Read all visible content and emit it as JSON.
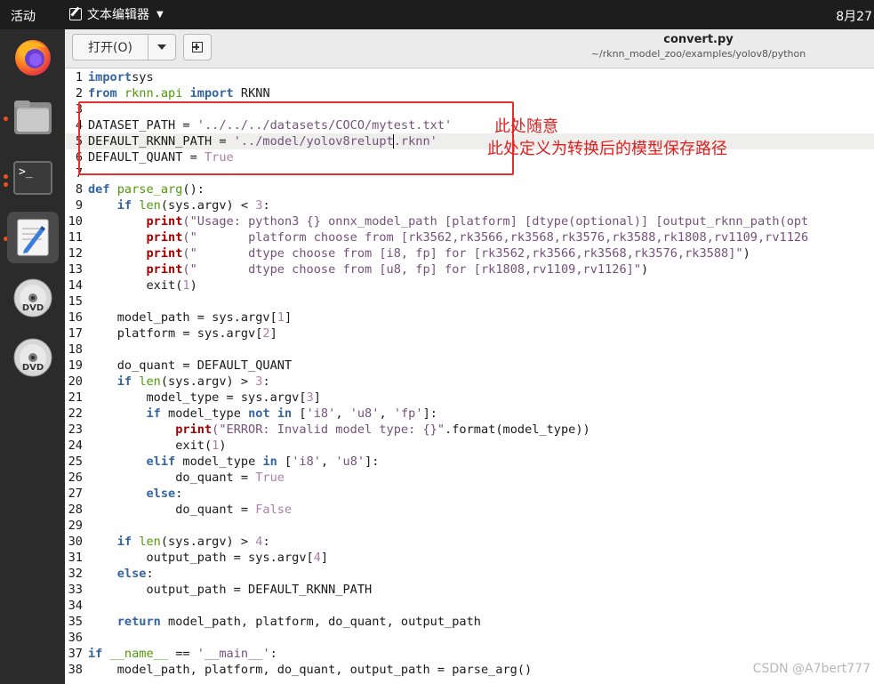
{
  "topbar": {
    "activities": "活动",
    "app_name": "文本编辑器",
    "clock": "8月27"
  },
  "dock": {
    "items": [
      {
        "name": "firefox-icon",
        "active": false,
        "running": false
      },
      {
        "name": "files-icon",
        "active": false,
        "running": true
      },
      {
        "name": "terminal-icon",
        "active": false,
        "running": true,
        "glyph": ">_"
      },
      {
        "name": "text-editor-icon",
        "active": true,
        "running": true
      },
      {
        "name": "dvd-icon",
        "label": "DVD"
      },
      {
        "name": "dvd-icon",
        "label": "DVD"
      }
    ]
  },
  "header": {
    "open_label": "打开(O)",
    "title": "convert.py",
    "subtitle": "~/rknn_model_zoo/examples/yolov8/python"
  },
  "annotation": {
    "note1": "此处随意",
    "note2": "此处定义为转换后的模型保存路径"
  },
  "watermark": "CSDN @A7bert777",
  "editor": {
    "lines": [
      {
        "n": "1",
        "t": [
          [
            "kw",
            "import"
          ],
          [
            "",
            "sys"
          ]
        ]
      },
      {
        "n": "2",
        "t": [
          [
            "kw",
            "from"
          ],
          [
            "",
            " "
          ],
          [
            "bi",
            "rknn.api"
          ],
          [
            "",
            " "
          ],
          [
            "kw",
            "import"
          ],
          [
            "",
            " RKNN"
          ]
        ]
      },
      {
        "n": "3",
        "t": []
      },
      {
        "n": "4",
        "t": [
          [
            "",
            "DATASET_PATH = "
          ],
          [
            "str",
            "'../../../datasets/COCO/mytest.txt'"
          ]
        ]
      },
      {
        "n": "5",
        "current": true,
        "t": [
          [
            "",
            "DEFAULT_RKNN_PATH = "
          ],
          [
            "str",
            "'../model/yolov8relupt"
          ],
          [
            "cursor",
            ""
          ],
          [
            "str",
            ".rknn'"
          ]
        ]
      },
      {
        "n": "6",
        "t": [
          [
            "",
            "DEFAULT_QUANT = "
          ],
          [
            "num",
            "True"
          ]
        ]
      },
      {
        "n": "7",
        "t": []
      },
      {
        "n": "8",
        "t": [
          [
            "kw",
            "def"
          ],
          [
            "",
            " "
          ],
          [
            "bi",
            "parse_arg"
          ],
          [
            "",
            "():"
          ]
        ]
      },
      {
        "n": "9",
        "t": [
          [
            "",
            "    "
          ],
          [
            "kw",
            "if"
          ],
          [
            "",
            " "
          ],
          [
            "bi",
            "len"
          ],
          [
            "",
            "(sys.argv) < "
          ],
          [
            "num",
            "3"
          ],
          [
            "",
            ":"
          ]
        ]
      },
      {
        "n": "10",
        "t": [
          [
            "",
            "        "
          ],
          [
            "kwp",
            "print"
          ],
          [
            "str",
            "(\"Usage: python3 {} onnx_model_path [platform] [dtype(optional)] [output_rknn_path(opt"
          ]
        ]
      },
      {
        "n": "11",
        "t": [
          [
            "",
            "        "
          ],
          [
            "kwp",
            "print"
          ],
          [
            "str",
            "(\"       platform choose from [rk3562,rk3566,rk3568,rk3576,rk3588,rk1808,rv1109,rv1126"
          ]
        ]
      },
      {
        "n": "12",
        "t": [
          [
            "",
            "        "
          ],
          [
            "kwp",
            "print"
          ],
          [
            "str",
            "(\"       dtype choose from [i8, fp] for [rk3562,rk3566,rk3568,rk3576,rk3588]\""
          ],
          [
            "",
            ")"
          ]
        ]
      },
      {
        "n": "13",
        "t": [
          [
            "",
            "        "
          ],
          [
            "kwp",
            "print"
          ],
          [
            "str",
            "(\"       dtype choose from [u8, fp] for [rk1808,rv1109,rv1126]\""
          ],
          [
            "",
            ")"
          ]
        ]
      },
      {
        "n": "14",
        "t": [
          [
            "",
            "        exit("
          ],
          [
            "num",
            "1"
          ],
          [
            "",
            ")"
          ]
        ]
      },
      {
        "n": "15",
        "t": []
      },
      {
        "n": "16",
        "t": [
          [
            "",
            "    model_path = sys.argv["
          ],
          [
            "num",
            "1"
          ],
          [
            "",
            "]"
          ]
        ]
      },
      {
        "n": "17",
        "t": [
          [
            "",
            "    platform = sys.argv["
          ],
          [
            "num",
            "2"
          ],
          [
            "",
            "]"
          ]
        ]
      },
      {
        "n": "18",
        "t": []
      },
      {
        "n": "19",
        "t": [
          [
            "",
            "    do_quant = DEFAULT_QUANT"
          ]
        ]
      },
      {
        "n": "20",
        "t": [
          [
            "",
            "    "
          ],
          [
            "kw",
            "if"
          ],
          [
            "",
            " "
          ],
          [
            "bi",
            "len"
          ],
          [
            "",
            "(sys.argv) > "
          ],
          [
            "num",
            "3"
          ],
          [
            "",
            ":"
          ]
        ]
      },
      {
        "n": "21",
        "t": [
          [
            "",
            "        model_type = sys.argv["
          ],
          [
            "num",
            "3"
          ],
          [
            "",
            "]"
          ]
        ]
      },
      {
        "n": "22",
        "t": [
          [
            "",
            "        "
          ],
          [
            "kw",
            "if"
          ],
          [
            "",
            " model_type "
          ],
          [
            "kw",
            "not in"
          ],
          [
            "",
            " ["
          ],
          [
            "str",
            "'i8'"
          ],
          [
            "",
            ", "
          ],
          [
            "str",
            "'u8'"
          ],
          [
            "",
            ", "
          ],
          [
            "str",
            "'fp'"
          ],
          [
            "",
            "]:"
          ]
        ]
      },
      {
        "n": "23",
        "t": [
          [
            "",
            "            "
          ],
          [
            "kwp",
            "print"
          ],
          [
            "str",
            "(\"ERROR: Invalid model type: {}\""
          ],
          [
            "",
            ".format(model_type))"
          ]
        ]
      },
      {
        "n": "24",
        "t": [
          [
            "",
            "            exit("
          ],
          [
            "num",
            "1"
          ],
          [
            "",
            ")"
          ]
        ]
      },
      {
        "n": "25",
        "t": [
          [
            "",
            "        "
          ],
          [
            "kw",
            "elif"
          ],
          [
            "",
            " model_type "
          ],
          [
            "kw",
            "in"
          ],
          [
            "",
            " ["
          ],
          [
            "str",
            "'i8'"
          ],
          [
            "",
            ", "
          ],
          [
            "str",
            "'u8'"
          ],
          [
            "",
            "]:"
          ]
        ]
      },
      {
        "n": "26",
        "t": [
          [
            "",
            "            do_quant = "
          ],
          [
            "num",
            "True"
          ]
        ]
      },
      {
        "n": "27",
        "t": [
          [
            "",
            "        "
          ],
          [
            "kw",
            "else"
          ],
          [
            "",
            ":"
          ]
        ]
      },
      {
        "n": "28",
        "t": [
          [
            "",
            "            do_quant = "
          ],
          [
            "num",
            "False"
          ]
        ]
      },
      {
        "n": "29",
        "t": []
      },
      {
        "n": "30",
        "t": [
          [
            "",
            "    "
          ],
          [
            "kw",
            "if"
          ],
          [
            "",
            " "
          ],
          [
            "bi",
            "len"
          ],
          [
            "",
            "(sys.argv) > "
          ],
          [
            "num",
            "4"
          ],
          [
            "",
            ":"
          ]
        ]
      },
      {
        "n": "31",
        "t": [
          [
            "",
            "        output_path = sys.argv["
          ],
          [
            "num",
            "4"
          ],
          [
            "",
            "]"
          ]
        ]
      },
      {
        "n": "32",
        "t": [
          [
            "",
            "    "
          ],
          [
            "kw",
            "else"
          ],
          [
            "",
            ":"
          ]
        ]
      },
      {
        "n": "33",
        "t": [
          [
            "",
            "        output_path = DEFAULT_RKNN_PATH"
          ]
        ]
      },
      {
        "n": "34",
        "t": []
      },
      {
        "n": "35",
        "t": [
          [
            "",
            "    "
          ],
          [
            "kw",
            "return"
          ],
          [
            "",
            " model_path, platform, do_quant, output_path"
          ]
        ]
      },
      {
        "n": "36",
        "t": []
      },
      {
        "n": "37",
        "t": [
          [
            "kw",
            "if"
          ],
          [
            "",
            " "
          ],
          [
            "bi",
            "__name__"
          ],
          [
            "",
            " == "
          ],
          [
            "str",
            "'__main__'"
          ],
          [
            "",
            ":"
          ]
        ]
      },
      {
        "n": "38",
        "t": [
          [
            "",
            "    model_path, platform, do_quant, output_path = parse_arg()"
          ]
        ]
      }
    ]
  }
}
